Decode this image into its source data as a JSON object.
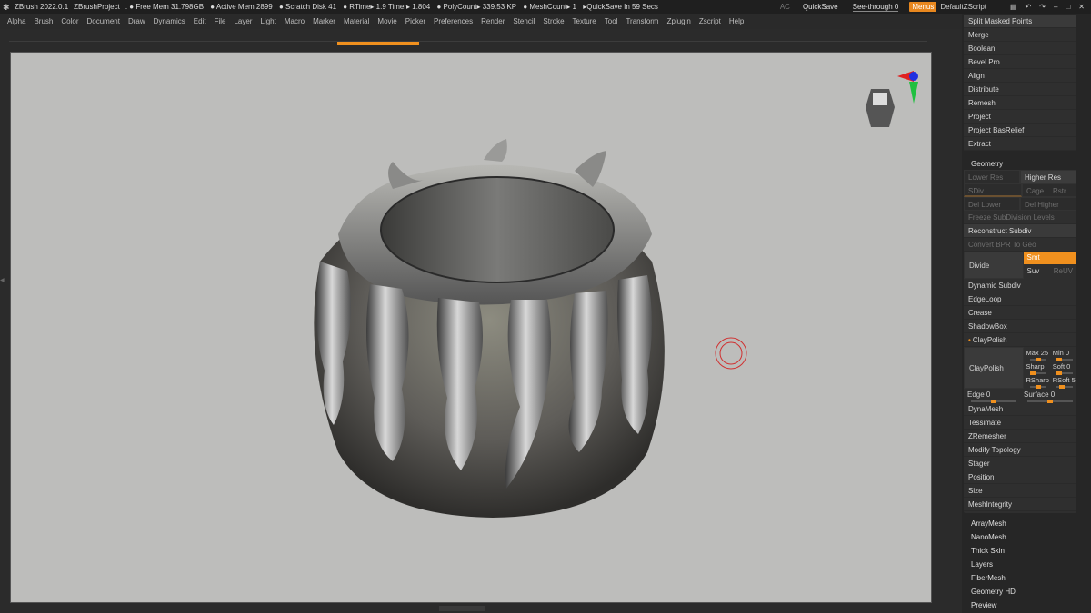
{
  "titlebar": {
    "app_title": "ZBrush 2022.0.1",
    "project": "ZBrushProject",
    "stats": [
      ". ● Free Mem 31.798GB",
      "● Active Mem 2899",
      "● Scratch Disk 41",
      "● RTime▸ 1.9 Timer▸ 1.804",
      "● PolyCount▸ 339.53 KP",
      "● MeshCount▸ 1",
      "▸QuickSave In 59 Secs"
    ],
    "ac_label": "AC",
    "quicksave_label": "QuickSave",
    "seethrough_label": "See-through  0",
    "menus_label": "Menus",
    "default_script_label": "DefaultZScript"
  },
  "menubar": {
    "items": [
      "Alpha",
      "Brush",
      "Color",
      "Document",
      "Draw",
      "Dynamics",
      "Edit",
      "File",
      "Layer",
      "Light",
      "Macro",
      "Marker",
      "Material",
      "Movie",
      "Picker",
      "Preferences",
      "Render",
      "Stencil",
      "Stroke",
      "Texture",
      "Tool",
      "Transform",
      "Zplugin",
      "Zscript",
      "Help"
    ]
  },
  "subtool_panel": {
    "items": [
      "Split Masked Points",
      "Merge",
      "Boolean",
      "Bevel Pro",
      "Align",
      "Distribute",
      "Remesh",
      "Project",
      "Project BasRelief",
      "Extract"
    ]
  },
  "geometry": {
    "header": "Geometry",
    "lower_res": "Lower Res",
    "higher_res": "Higher Res",
    "sdiv": "SDiv",
    "cage": "Cage",
    "rstr": "Rstr",
    "del_lower": "Del Lower",
    "del_higher": "Del Higher",
    "freeze": "Freeze SubDivision Levels",
    "reconstruct": "Reconstruct Subdiv",
    "convert_bpr": "Convert BPR To Geo",
    "divide": "Divide",
    "smt": "Smt",
    "suv": "Suv",
    "reuv": "ReUV",
    "items_a": [
      "Dynamic Subdiv",
      "EdgeLoop",
      "Crease",
      "ShadowBox"
    ],
    "claypolish_header": "ClayPolish",
    "claypolish_btn": "ClayPolish",
    "max": "Max 25",
    "min": "Min 0",
    "sharp": "Sharp",
    "soft": "Soft 0",
    "rsharp": "RSharp",
    "rsoft": "RSoft 5",
    "edge": "Edge 0",
    "surface": "Surface 0",
    "items_b": [
      "DynaMesh",
      "Tessimate",
      "ZRemesher",
      "Modify Topology",
      "Stager",
      "Position",
      "Size",
      "MeshIntegrity"
    ]
  },
  "bottom_list": {
    "items": [
      "ArrayMesh",
      "NanoMesh",
      "Thick Skin",
      "Layers",
      "FiberMesh",
      "Geometry HD",
      "Preview"
    ]
  },
  "colors": {
    "accent": "#f0901e",
    "canvas": "#bdbdbb",
    "panel": "#262626",
    "gizmo_x": "#e02020",
    "gizmo_y": "#20c040",
    "gizmo_z": "#2030e0"
  }
}
